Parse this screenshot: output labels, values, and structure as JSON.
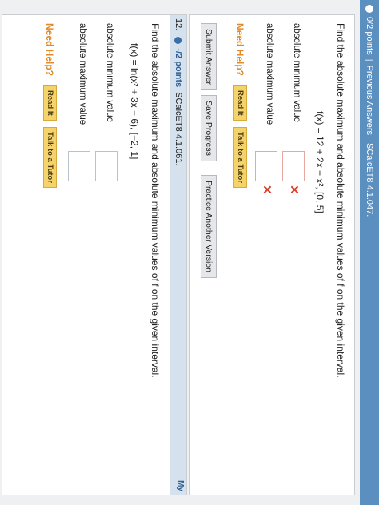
{
  "top_bar": {
    "points": "0/2 points",
    "previous": "Previous Answers",
    "source": "SCalcET8 4.1.047."
  },
  "q11": {
    "prompt": "Find the absolute maximum and absolute minimum values of f on the given interval.",
    "function": "f(x) = 12 + 2x − x², [0, 5]",
    "min_label": "absolute minimum value",
    "max_label": "absolute maximum value",
    "need_help": "Need Help?",
    "read_it": "Read It",
    "talk_tutor": "Talk to a Tutor"
  },
  "actions": {
    "submit": "Submit Answer",
    "save": "Save Progress",
    "practice": "Practice Another Version"
  },
  "q12": {
    "number": "12.",
    "points": "-/2 points",
    "source": "SCalcET8 4.1.061.",
    "my_tab": "My",
    "prompt": "Find the absolute maximum and absolute minimum values of f on the given interval.",
    "function": "f(x) = ln(x² + 3x + 6), [−2, 1]",
    "min_label": "absolute minimum value",
    "max_label": "absolute maximum value",
    "need_help": "Need Help?",
    "read_it": "Read It",
    "talk_tutor": "Talk to a Tutor"
  },
  "colors": {
    "accent": "#5b8fc0",
    "error": "#d9412e",
    "help": "#e08a2a"
  }
}
